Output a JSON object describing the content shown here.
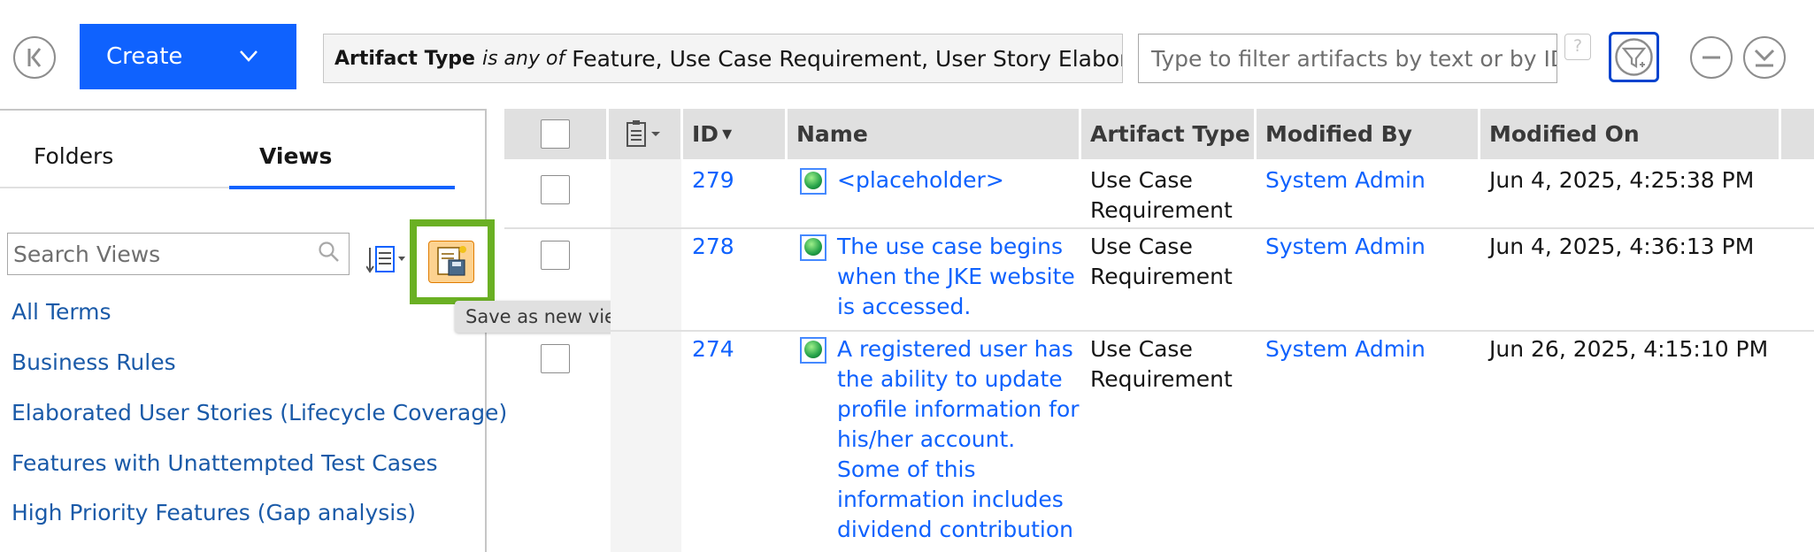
{
  "toolbar": {
    "create_label": "Create",
    "filter_field": "Artifact Type",
    "filter_operator": "is any of",
    "filter_values": "Feature, Use Case Requirement, User Story Elaboration",
    "search_placeholder": "Type to filter artifacts by text or by ID",
    "help_glyph": "?"
  },
  "left_panel": {
    "tabs": [
      {
        "label": "Folders",
        "active": false
      },
      {
        "label": "Views",
        "active": true
      }
    ],
    "search_placeholder": "Search Views",
    "save_view_tooltip": "Save as new view",
    "views": [
      "All Terms",
      "Business Rules",
      "Elaborated User Stories (Lifecycle Coverage)",
      "Features with Unattempted Test Cases",
      "High Priority Features (Gap analysis)"
    ]
  },
  "grid": {
    "columns": [
      "ID",
      "Name",
      "Artifact Type",
      "Modified By",
      "Modified On"
    ],
    "sort_indicator": "▾",
    "rows": [
      {
        "id": "279",
        "name_lines": [
          "<placeholder>"
        ],
        "type_lines": [
          "Use Case",
          "Requirement"
        ],
        "modified_by": "System Admin",
        "modified_on": "Jun 4, 2025, 4:25:38 PM"
      },
      {
        "id": "278",
        "name_lines": [
          "The use case begins",
          "when the JKE website",
          "is accessed."
        ],
        "type_lines": [
          "Use Case",
          "Requirement"
        ],
        "modified_by": "System Admin",
        "modified_on": "Jun 4, 2025, 4:36:13 PM"
      },
      {
        "id": "274",
        "name_lines": [
          "A registered user has",
          "the ability to update",
          "profile information for",
          "his/her account.",
          "Some of this",
          "information includes",
          "dividend contribution"
        ],
        "type_lines": [
          "Use Case",
          "Requirement"
        ],
        "modified_by": "System Admin",
        "modified_on": "Jun 26, 2025, 4:15:10 PM"
      }
    ]
  },
  "colors": {
    "primary": "#0f62fe",
    "highlight": "#6ab023",
    "link": "#0f62fe",
    "view_link": "#1a5aa8"
  },
  "icons": [
    "collapse-left-icon",
    "chevron-down-icon",
    "help-icon",
    "filter-funnel-icon",
    "minus-circle-icon",
    "chevron-down-circle-icon",
    "search-icon",
    "sort-list-icon",
    "save-view-icon",
    "column-config-icon",
    "artifact-requirement-icon"
  ]
}
